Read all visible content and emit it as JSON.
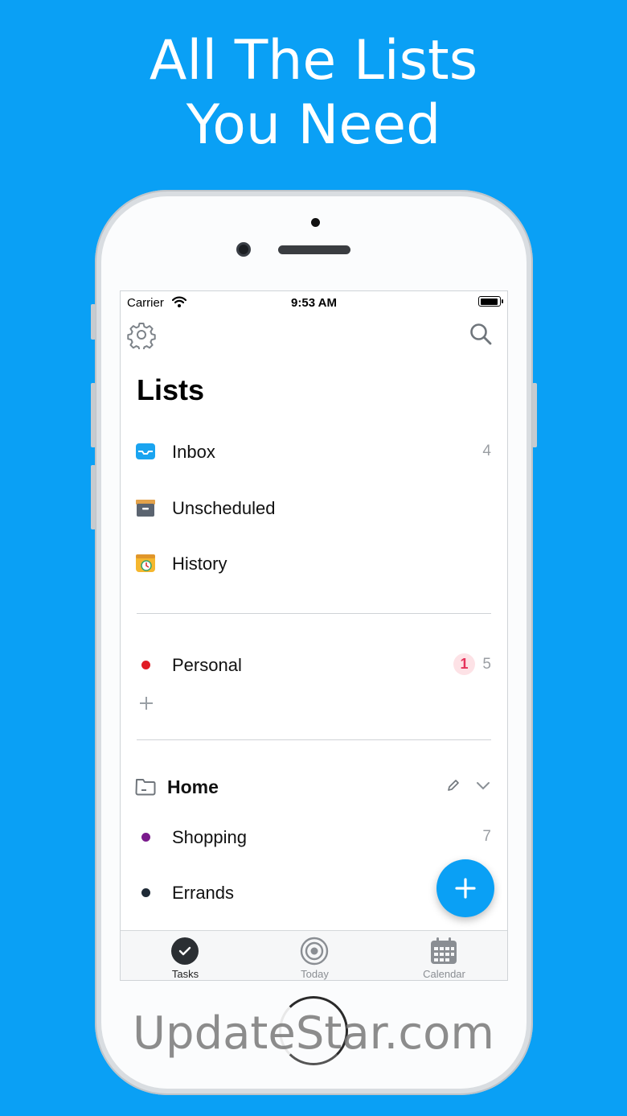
{
  "headline": {
    "line1": "All The Lists",
    "line2": "You Need"
  },
  "status_bar": {
    "carrier": "Carrier",
    "time": "9:53 AM",
    "battery_level": 0.95
  },
  "header": {
    "title": "Lists",
    "settings_icon": "gear-icon",
    "search_icon": "search-icon"
  },
  "smart_lists": [
    {
      "label": "Inbox",
      "count": "4",
      "icon": "inbox-tray-icon",
      "color": "#1aa4f0"
    },
    {
      "label": "Unscheduled",
      "count": "",
      "icon": "archive-box-icon",
      "color": "#5b6470"
    },
    {
      "label": "History",
      "count": "",
      "icon": "history-calendar-icon",
      "color": "#f5b72e"
    }
  ],
  "lists": [
    {
      "label": "Personal",
      "badge": "1",
      "count": "5",
      "color": "#e01b24"
    }
  ],
  "folder": {
    "label": "Home",
    "items": [
      {
        "label": "Shopping",
        "count": "7",
        "color": "#7a1a8c"
      },
      {
        "label": "Errands",
        "count": "",
        "color": "#1f2a36"
      }
    ]
  },
  "tabs": [
    {
      "label": "Tasks",
      "icon": "checkmark-circle-icon",
      "active": true
    },
    {
      "label": "Today",
      "icon": "target-icon",
      "active": false
    },
    {
      "label": "Calendar",
      "icon": "calendar-icon",
      "active": false
    }
  ],
  "watermark": "UpdateStar.com",
  "colors": {
    "background": "#0aa0f5",
    "accent": "#0aa0f5",
    "badge_text": "#e5325a",
    "badge_bg": "#fde2e6"
  }
}
